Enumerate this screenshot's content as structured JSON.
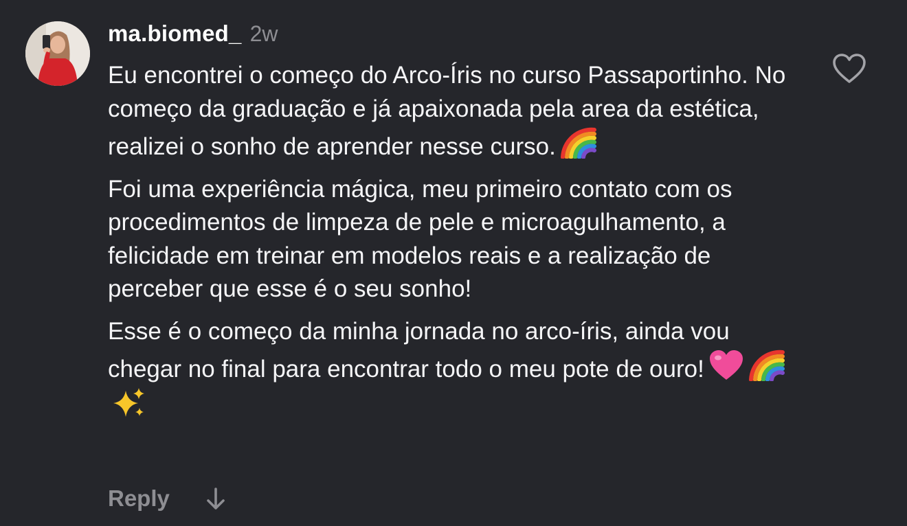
{
  "comment": {
    "avatar_icon": "user-photo-avatar",
    "username": "ma.biomed_",
    "timestamp": "2w",
    "paragraphs": [
      {
        "text": "Eu encontrei o começo do Arco-Íris no curso Passaportinho. No começo da graduação e já apaixonada pela area da estética, realizei o sonho de aprender nesse curso.",
        "emojis": [
          "rainbow-emoji"
        ]
      },
      {
        "text": "Foi uma experiência mágica, meu primeiro contato com os procedimentos de limpeza de pele e microagulhamento, a felicidade em treinar em modelos reais e a realização de perceber que esse é o seu sonho!",
        "emojis": []
      },
      {
        "text": "Esse é o começo da minha jornada no arco-íris, ainda vou chegar no final para encontrar todo o meu pote de ouro!",
        "emojis": [
          "pink-heart-emoji",
          "rainbow-emoji",
          "sparkles-emoji"
        ]
      }
    ],
    "like_icon": "heart-outline-icon",
    "reply_label": "Reply",
    "reply_arrow_icon": "arrow-down-icon"
  },
  "colors": {
    "background": "#25262b",
    "text": "#f5f5f7",
    "muted": "#8e8e93"
  }
}
